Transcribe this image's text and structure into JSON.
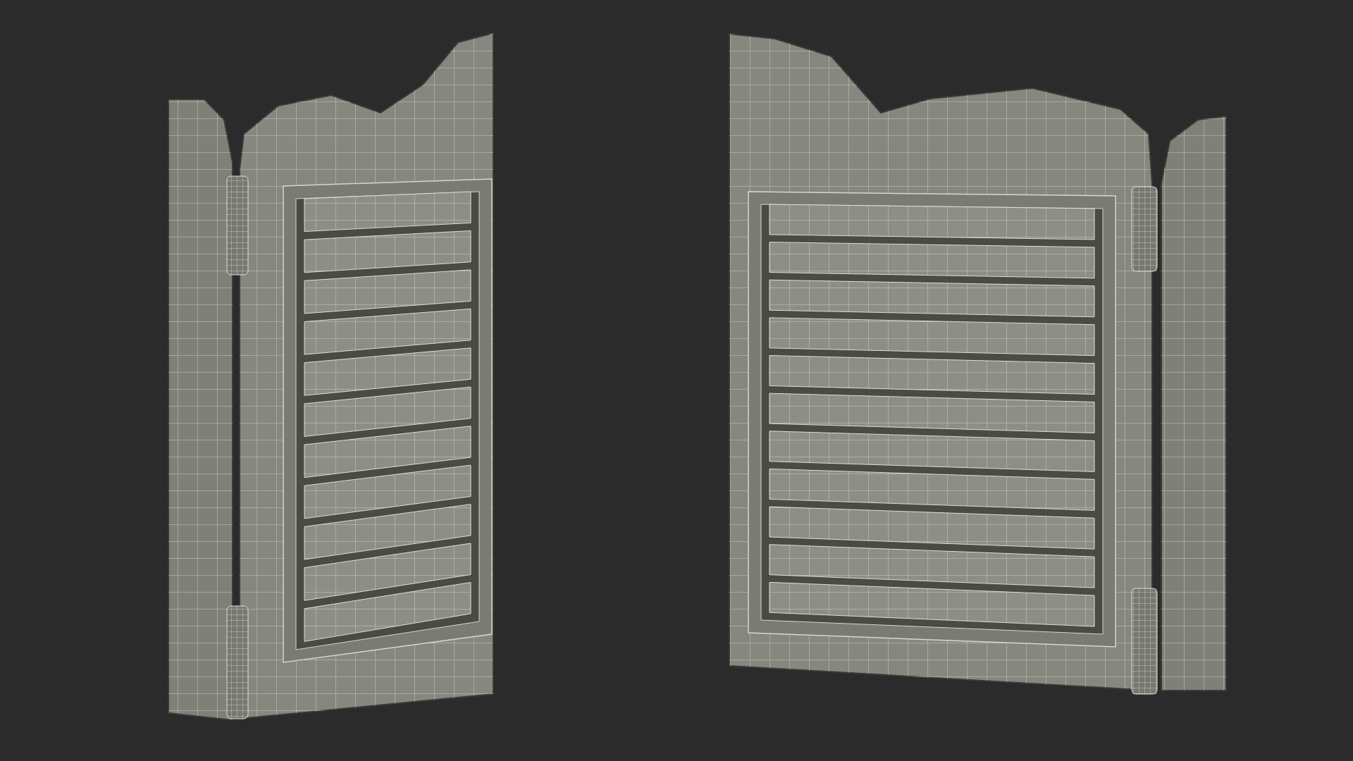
{
  "scene": {
    "objects": [
      {
        "kind": "left-door"
      },
      {
        "kind": "right-door"
      }
    ]
  }
}
